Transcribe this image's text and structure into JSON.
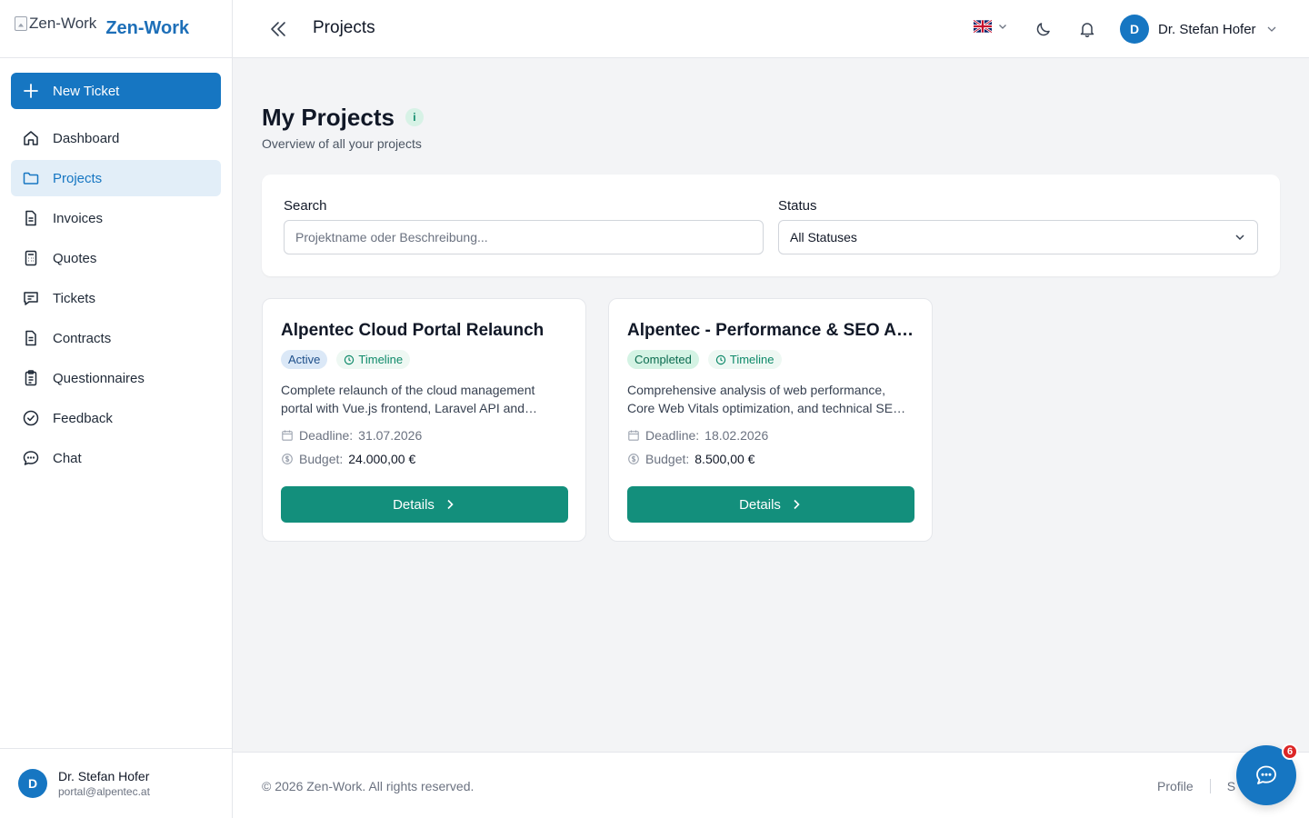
{
  "brand": {
    "logo_alt": "Zen-Work",
    "name": "Zen-Work",
    "accent": "#1676c2"
  },
  "sidebar": {
    "new_ticket": "New Ticket",
    "items": [
      {
        "label": "Dashboard",
        "icon": "home-icon"
      },
      {
        "label": "Projects",
        "icon": "folder-icon",
        "active": true
      },
      {
        "label": "Invoices",
        "icon": "document-icon"
      },
      {
        "label": "Quotes",
        "icon": "calculator-icon"
      },
      {
        "label": "Tickets",
        "icon": "chat-square-icon"
      },
      {
        "label": "Contracts",
        "icon": "document-text-icon"
      },
      {
        "label": "Questionnaires",
        "icon": "clipboard-icon"
      },
      {
        "label": "Feedback",
        "icon": "check-circle-icon"
      },
      {
        "label": "Chat",
        "icon": "chat-bubble-icon"
      }
    ],
    "user": {
      "initial": "D",
      "name": "Dr. Stefan Hofer",
      "email": "portal@alpentec.at"
    }
  },
  "header": {
    "title": "Projects",
    "language": "uk-flag-icon",
    "user": {
      "initial": "D",
      "name": "Dr. Stefan Hofer"
    }
  },
  "main": {
    "title": "My Projects",
    "info": "i",
    "subtitle": "Overview of all your projects",
    "filters": {
      "search_label": "Search",
      "search_placeholder": "Projektname oder Beschreibung...",
      "search_value": "",
      "status_label": "Status",
      "status_value": "All Statuses"
    },
    "projects": [
      {
        "title": "Alpentec Cloud Portal Relaunch",
        "status": "Active",
        "timeline": "Timeline",
        "description": "Complete relaunch of the cloud management portal with Vue.js frontend, Laravel API and extended reporting features.",
        "deadline_label": "Deadline:",
        "deadline": "31.07.2026",
        "budget_label": "Budget:",
        "budget": "24.000,00 €",
        "details": "Details"
      },
      {
        "title": "Alpentec - Performance & SEO Audit",
        "status": "Completed",
        "timeline": "Timeline",
        "description": "Comprehensive analysis of web performance, Core Web Vitals optimization, and technical SEO improvements.",
        "deadline_label": "Deadline:",
        "deadline": "18.02.2026",
        "budget_label": "Budget:",
        "budget": "8.500,00 €",
        "details": "Details"
      }
    ]
  },
  "footer": {
    "copyright": "© 2026 Zen-Work. All rights reserved.",
    "links": [
      "Profile",
      "S"
    ]
  },
  "chat_fab": {
    "badge": "6"
  }
}
